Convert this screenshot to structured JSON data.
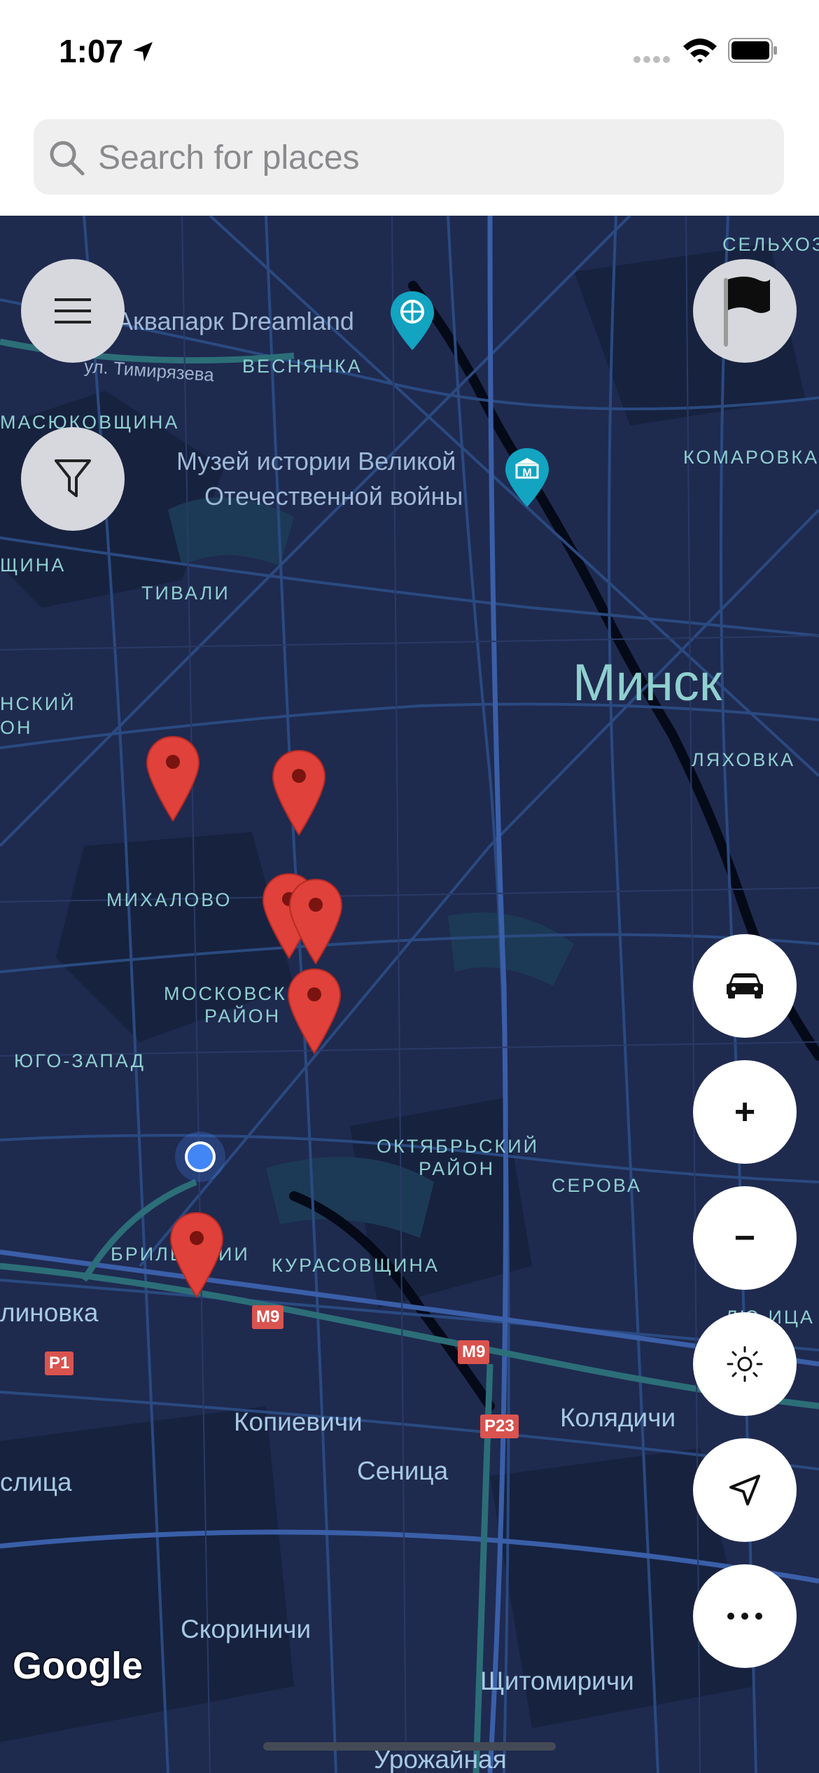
{
  "status_bar": {
    "time": "1:07"
  },
  "search": {
    "placeholder": "Search for places"
  },
  "map": {
    "city": "Минск",
    "districts": [
      "СЕЛЬХОЗ",
      "ВЕСНЯНКА",
      "МАСЮКОВЩИНА",
      "КОМАРОВКА",
      "ЩИНА",
      "ТИВАЛИ",
      "НСКИЙ",
      "ОН",
      "ЛЯХОВКА",
      "МИХАЛОВО",
      "МОСКОВСК",
      "РАЙОН",
      "ЮГО-ЗАПАД",
      "ОКТЯБРЬСКИЙ",
      "РАЙОН",
      "СЕРОВА",
      "БРИЛЬ",
      "ИИ",
      "КУРАСОВЩИНА",
      "ЛЮ ИЦА"
    ],
    "pois": [
      "Аквапарк Dreamland",
      "Музей истории Великой",
      "Отечественной войны"
    ],
    "streets": [
      "ул. Тимирязева"
    ],
    "towns": [
      "линовка",
      "Копиевичи",
      "Колядичи",
      "Сеница",
      "слица",
      "Скориничи",
      "Щитомиричи",
      "Урожайная"
    ],
    "road_shields": [
      "M9",
      "M9",
      "P1",
      "P23"
    ],
    "attribution": "Google"
  },
  "controls": {
    "menu": "menu-icon",
    "filter": "filter-icon",
    "flag": "flag-icon",
    "car": "car-icon",
    "zoom_in": "+",
    "zoom_out": "−",
    "theme": "sun-icon",
    "locate": "navigation-arrow-icon",
    "more": "more-icon"
  },
  "colors": {
    "map_bg": "#1f2a4f",
    "pin": "#e0413a",
    "user_location": "#4285f4"
  }
}
